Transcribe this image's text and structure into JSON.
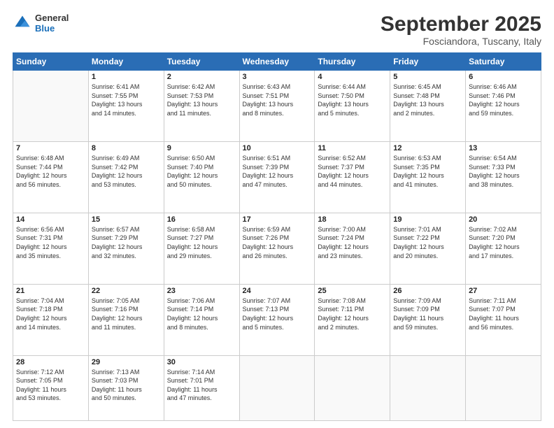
{
  "logo": {
    "line1": "General",
    "line2": "Blue"
  },
  "title": "September 2025",
  "location": "Fosciandora, Tuscany, Italy",
  "days_of_week": [
    "Sunday",
    "Monday",
    "Tuesday",
    "Wednesday",
    "Thursday",
    "Friday",
    "Saturday"
  ],
  "weeks": [
    [
      {
        "day": "",
        "content": ""
      },
      {
        "day": "1",
        "content": "Sunrise: 6:41 AM\nSunset: 7:55 PM\nDaylight: 13 hours\nand 14 minutes."
      },
      {
        "day": "2",
        "content": "Sunrise: 6:42 AM\nSunset: 7:53 PM\nDaylight: 13 hours\nand 11 minutes."
      },
      {
        "day": "3",
        "content": "Sunrise: 6:43 AM\nSunset: 7:51 PM\nDaylight: 13 hours\nand 8 minutes."
      },
      {
        "day": "4",
        "content": "Sunrise: 6:44 AM\nSunset: 7:50 PM\nDaylight: 13 hours\nand 5 minutes."
      },
      {
        "day": "5",
        "content": "Sunrise: 6:45 AM\nSunset: 7:48 PM\nDaylight: 13 hours\nand 2 minutes."
      },
      {
        "day": "6",
        "content": "Sunrise: 6:46 AM\nSunset: 7:46 PM\nDaylight: 12 hours\nand 59 minutes."
      }
    ],
    [
      {
        "day": "7",
        "content": "Sunrise: 6:48 AM\nSunset: 7:44 PM\nDaylight: 12 hours\nand 56 minutes."
      },
      {
        "day": "8",
        "content": "Sunrise: 6:49 AM\nSunset: 7:42 PM\nDaylight: 12 hours\nand 53 minutes."
      },
      {
        "day": "9",
        "content": "Sunrise: 6:50 AM\nSunset: 7:40 PM\nDaylight: 12 hours\nand 50 minutes."
      },
      {
        "day": "10",
        "content": "Sunrise: 6:51 AM\nSunset: 7:39 PM\nDaylight: 12 hours\nand 47 minutes."
      },
      {
        "day": "11",
        "content": "Sunrise: 6:52 AM\nSunset: 7:37 PM\nDaylight: 12 hours\nand 44 minutes."
      },
      {
        "day": "12",
        "content": "Sunrise: 6:53 AM\nSunset: 7:35 PM\nDaylight: 12 hours\nand 41 minutes."
      },
      {
        "day": "13",
        "content": "Sunrise: 6:54 AM\nSunset: 7:33 PM\nDaylight: 12 hours\nand 38 minutes."
      }
    ],
    [
      {
        "day": "14",
        "content": "Sunrise: 6:56 AM\nSunset: 7:31 PM\nDaylight: 12 hours\nand 35 minutes."
      },
      {
        "day": "15",
        "content": "Sunrise: 6:57 AM\nSunset: 7:29 PM\nDaylight: 12 hours\nand 32 minutes."
      },
      {
        "day": "16",
        "content": "Sunrise: 6:58 AM\nSunset: 7:27 PM\nDaylight: 12 hours\nand 29 minutes."
      },
      {
        "day": "17",
        "content": "Sunrise: 6:59 AM\nSunset: 7:26 PM\nDaylight: 12 hours\nand 26 minutes."
      },
      {
        "day": "18",
        "content": "Sunrise: 7:00 AM\nSunset: 7:24 PM\nDaylight: 12 hours\nand 23 minutes."
      },
      {
        "day": "19",
        "content": "Sunrise: 7:01 AM\nSunset: 7:22 PM\nDaylight: 12 hours\nand 20 minutes."
      },
      {
        "day": "20",
        "content": "Sunrise: 7:02 AM\nSunset: 7:20 PM\nDaylight: 12 hours\nand 17 minutes."
      }
    ],
    [
      {
        "day": "21",
        "content": "Sunrise: 7:04 AM\nSunset: 7:18 PM\nDaylight: 12 hours\nand 14 minutes."
      },
      {
        "day": "22",
        "content": "Sunrise: 7:05 AM\nSunset: 7:16 PM\nDaylight: 12 hours\nand 11 minutes."
      },
      {
        "day": "23",
        "content": "Sunrise: 7:06 AM\nSunset: 7:14 PM\nDaylight: 12 hours\nand 8 minutes."
      },
      {
        "day": "24",
        "content": "Sunrise: 7:07 AM\nSunset: 7:13 PM\nDaylight: 12 hours\nand 5 minutes."
      },
      {
        "day": "25",
        "content": "Sunrise: 7:08 AM\nSunset: 7:11 PM\nDaylight: 12 hours\nand 2 minutes."
      },
      {
        "day": "26",
        "content": "Sunrise: 7:09 AM\nSunset: 7:09 PM\nDaylight: 11 hours\nand 59 minutes."
      },
      {
        "day": "27",
        "content": "Sunrise: 7:11 AM\nSunset: 7:07 PM\nDaylight: 11 hours\nand 56 minutes."
      }
    ],
    [
      {
        "day": "28",
        "content": "Sunrise: 7:12 AM\nSunset: 7:05 PM\nDaylight: 11 hours\nand 53 minutes."
      },
      {
        "day": "29",
        "content": "Sunrise: 7:13 AM\nSunset: 7:03 PM\nDaylight: 11 hours\nand 50 minutes."
      },
      {
        "day": "30",
        "content": "Sunrise: 7:14 AM\nSunset: 7:01 PM\nDaylight: 11 hours\nand 47 minutes."
      },
      {
        "day": "",
        "content": ""
      },
      {
        "day": "",
        "content": ""
      },
      {
        "day": "",
        "content": ""
      },
      {
        "day": "",
        "content": ""
      }
    ]
  ]
}
